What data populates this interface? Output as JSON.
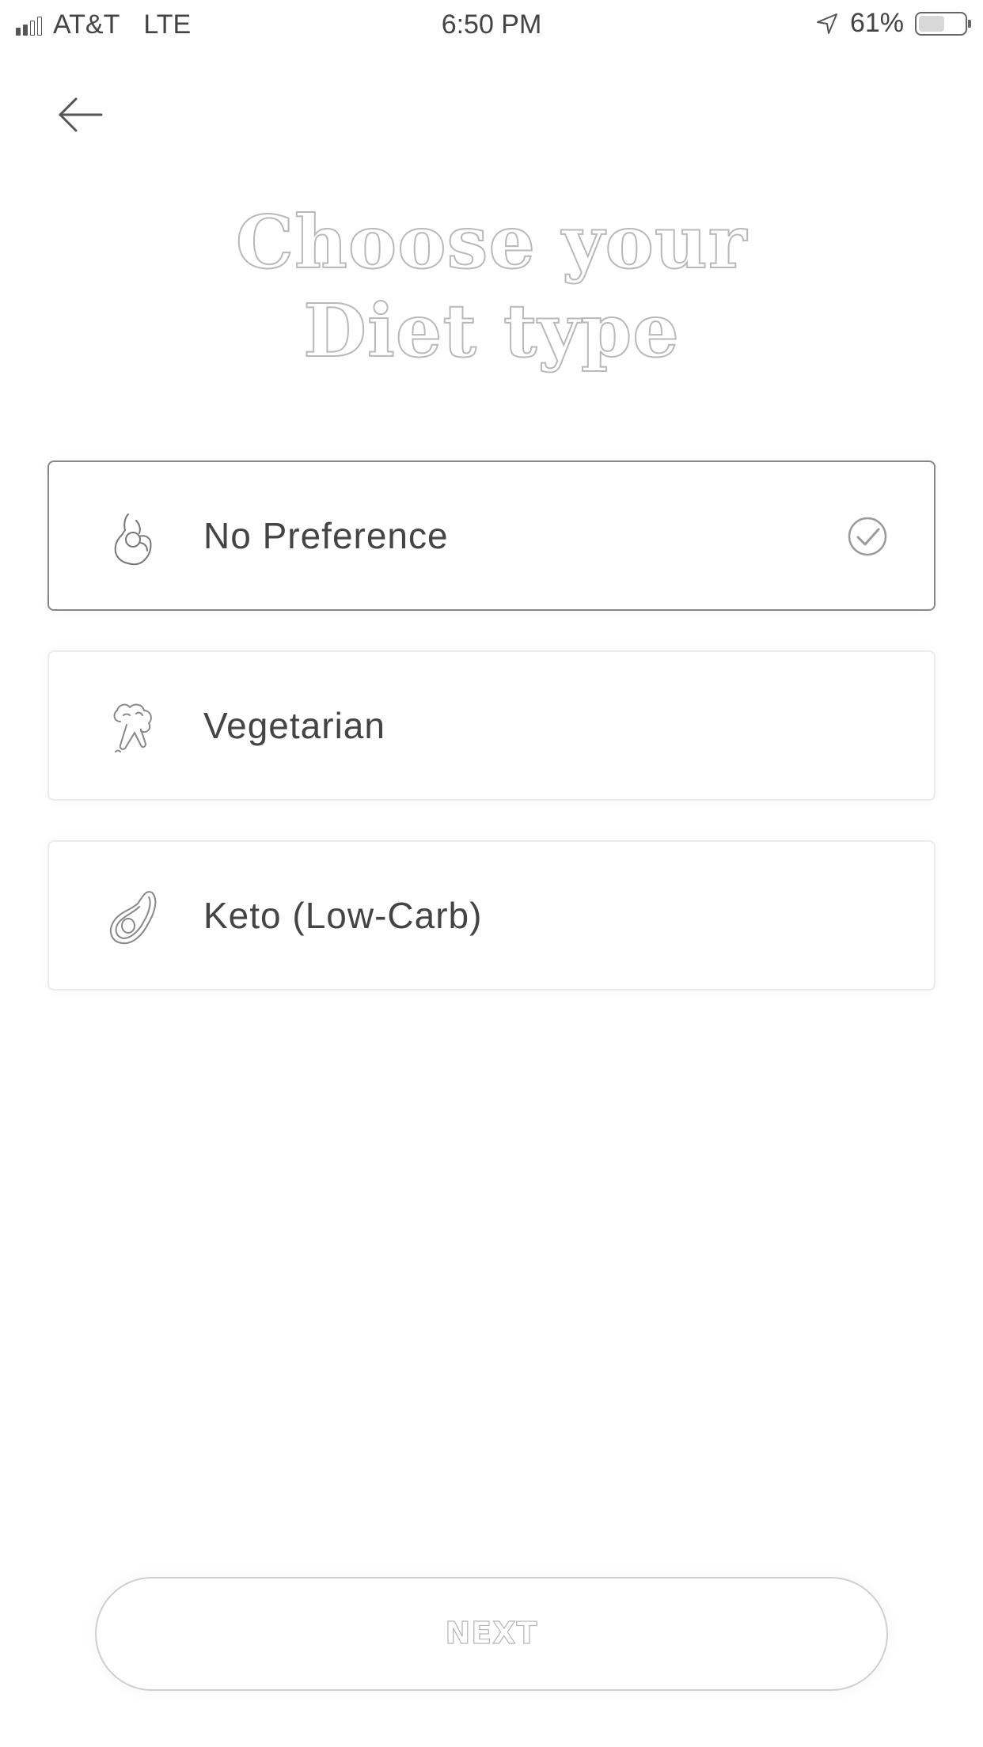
{
  "status_bar": {
    "carrier": "AT&T",
    "network": "LTE",
    "time": "6:50 PM",
    "battery_percent": "61%",
    "battery_level": 0.61,
    "signal_bars_filled": 2,
    "signal_bars_total": 4
  },
  "header": {
    "back_icon": "arrow-left-icon",
    "title_line1": "Choose your",
    "title_line2": "Diet type"
  },
  "options": [
    {
      "label": "No Preference",
      "icon": "ok-hand-icon",
      "selected": true
    },
    {
      "label": "Vegetarian",
      "icon": "broccoli-icon",
      "selected": false
    },
    {
      "label": "Keto (Low-Carb)",
      "icon": "avocado-icon",
      "selected": false
    }
  ],
  "footer": {
    "next_label": "NEXT"
  },
  "colors": {
    "background": "#ffffff",
    "text": "#444444",
    "card_border": "#ececec",
    "card_border_selected": "#888888",
    "title_outline": "#b9b9b9"
  }
}
